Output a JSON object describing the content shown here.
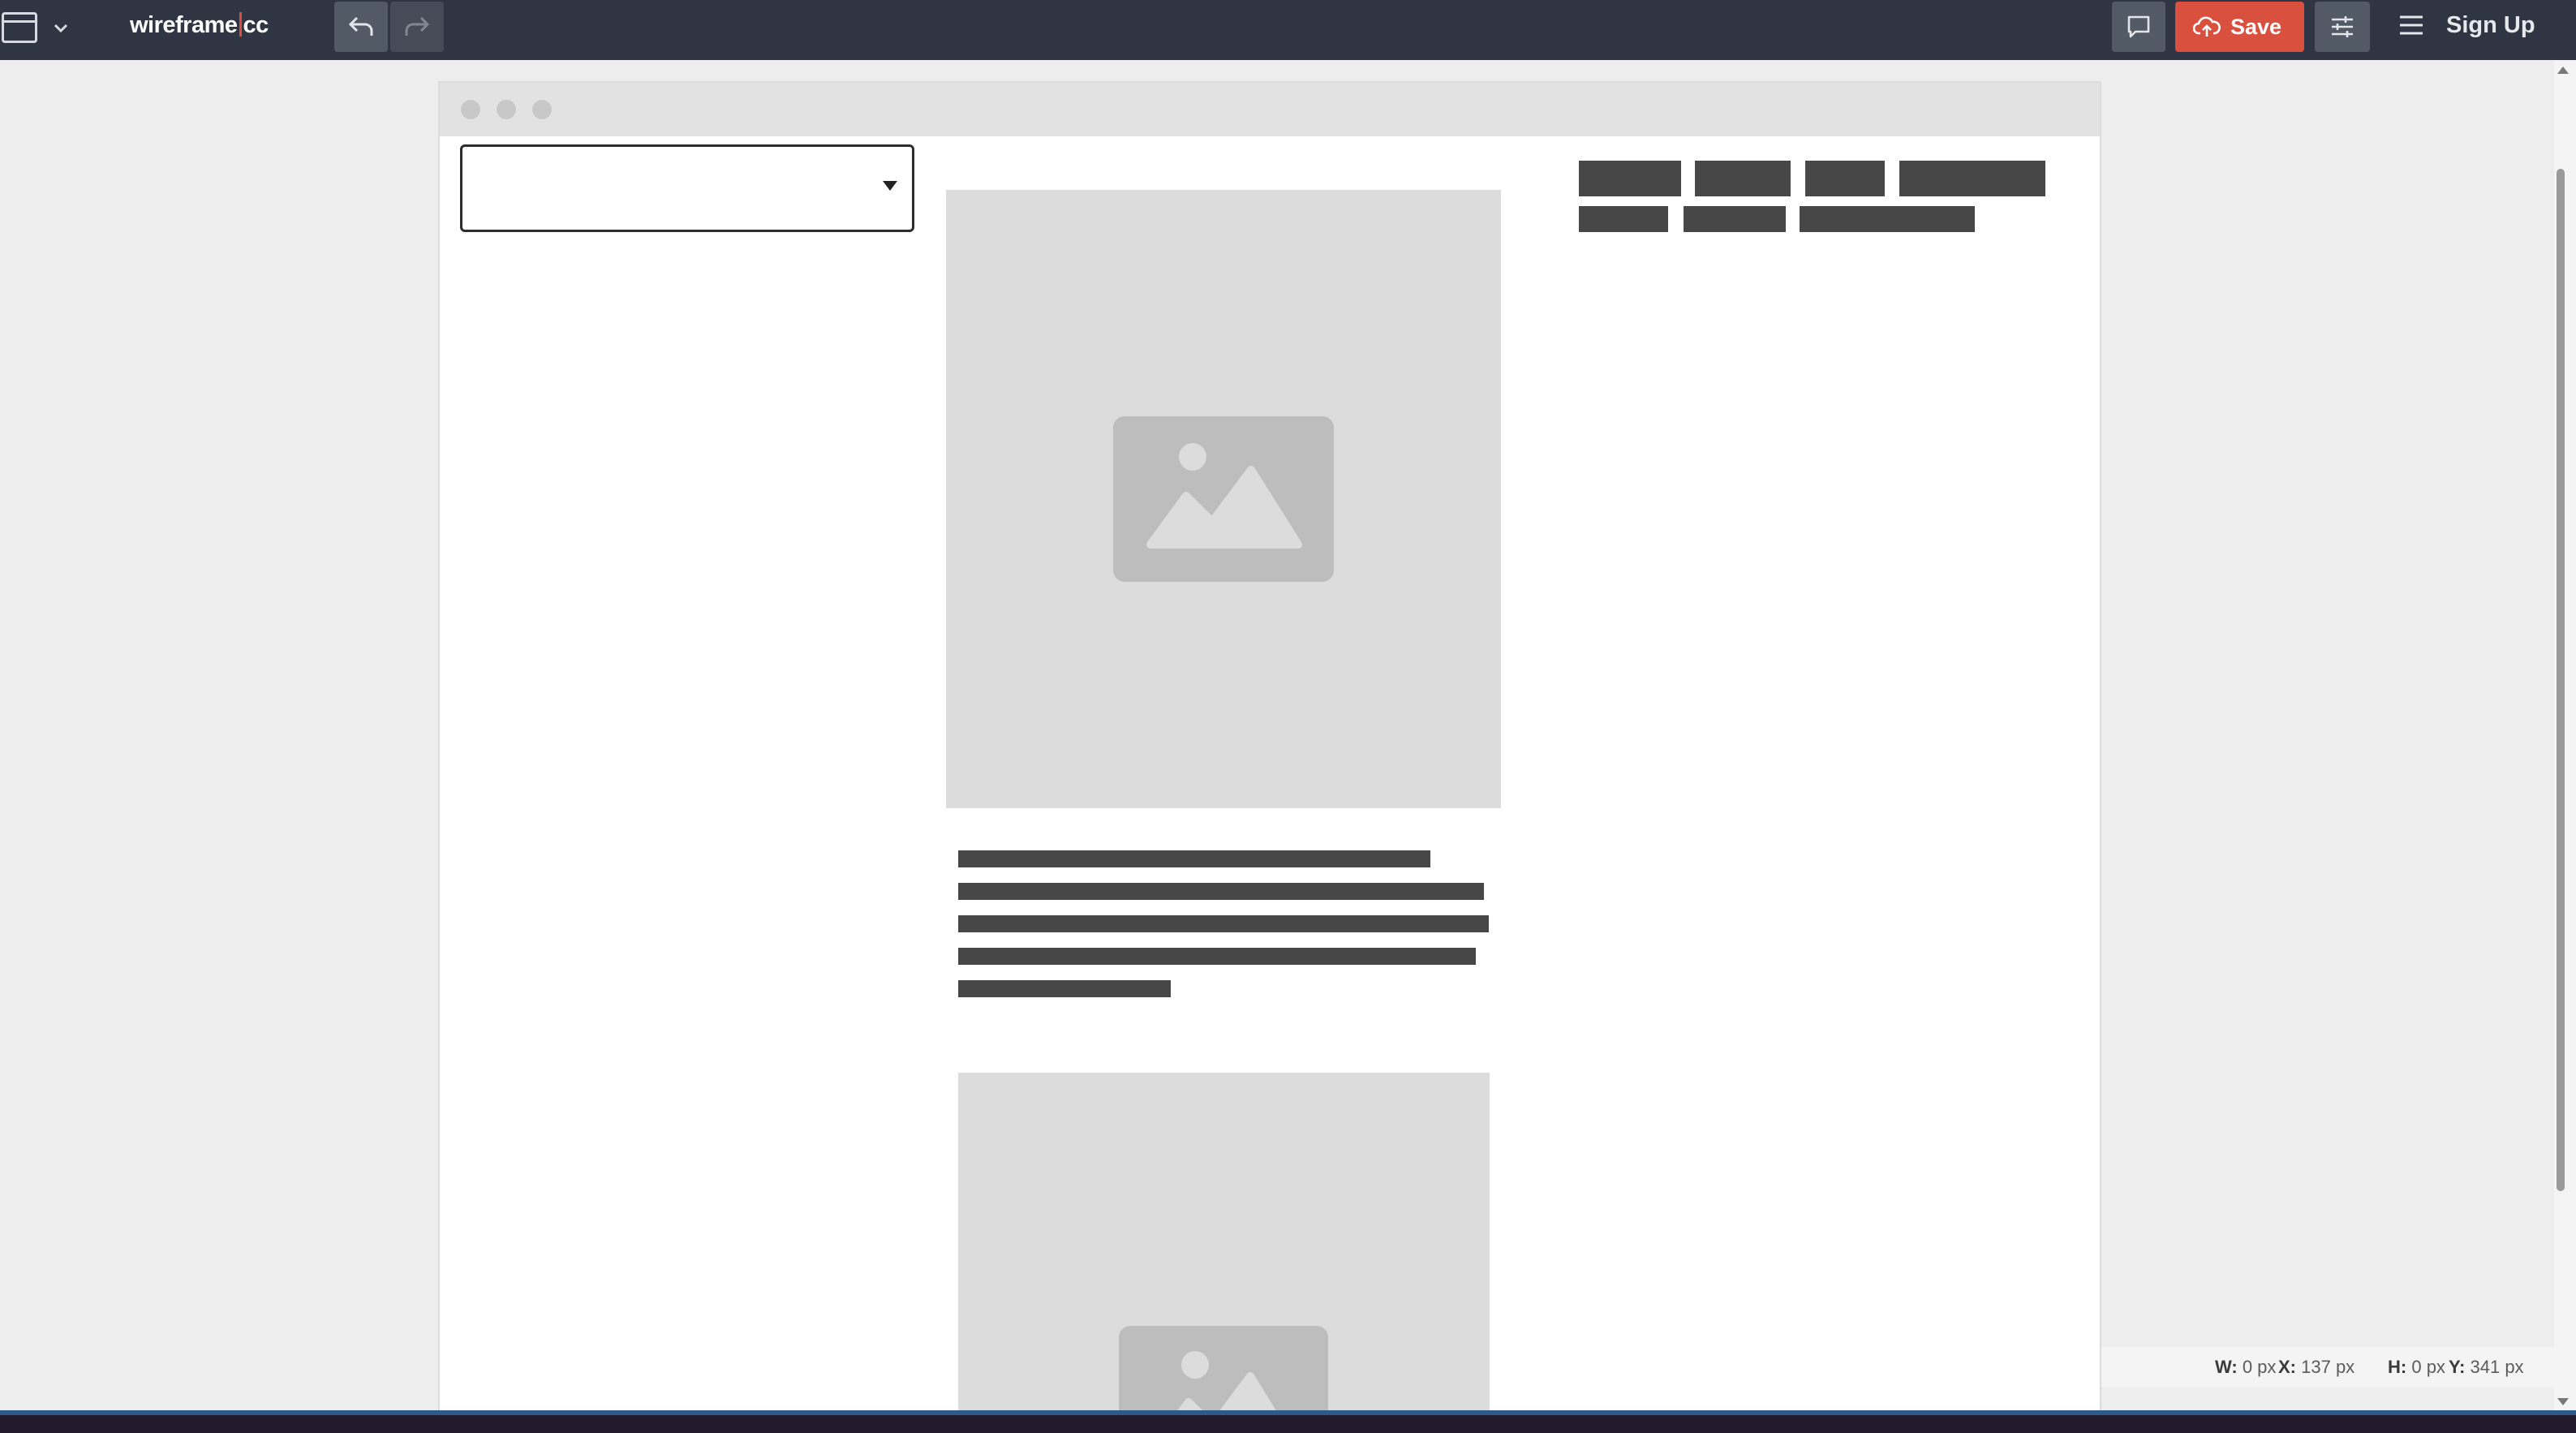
{
  "app": {
    "logo_left": "wireframe",
    "logo_right": "cc",
    "save_label": "Save",
    "signup_label": "Sign Up"
  },
  "icons": {
    "page": "browser-window-icon",
    "chevron": "chevron-down-icon",
    "undo": "undo-icon",
    "redo": "redo-icon",
    "comment": "comment-icon",
    "save": "cloud-upload-icon",
    "settings": "sliders-icon",
    "menu": "hamburger-menu-icon",
    "image": "image-placeholder-icon"
  },
  "colors": {
    "topbar": "#2f3542",
    "accent": "#d9503f",
    "placeholder": "#dcdcdc",
    "text_block": "#474747"
  },
  "status": {
    "x_label": "X:",
    "x_value": "137 px",
    "y_label": "Y:",
    "y_value": "341 px",
    "w_label": "W:",
    "w_value": "0 px",
    "h_label": "H:",
    "h_value": "0 px"
  }
}
